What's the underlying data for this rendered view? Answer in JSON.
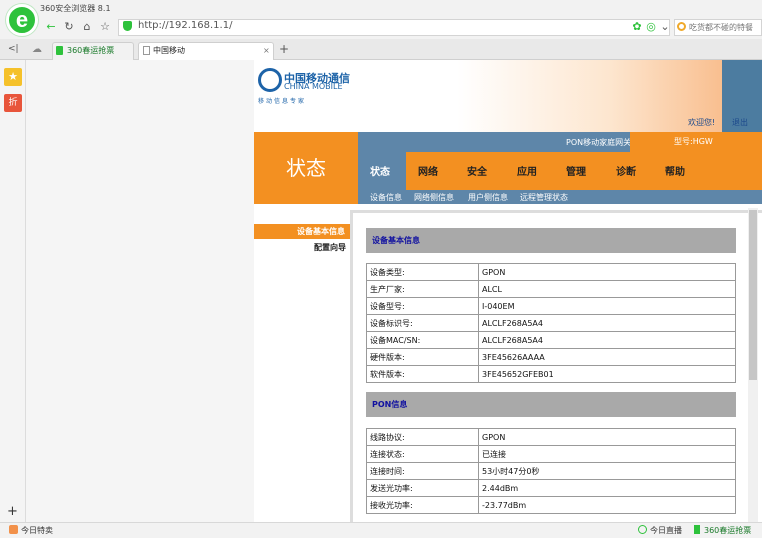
{
  "browser": {
    "app_title": "360安全浏览器 8.1",
    "logo_letter": "e",
    "address": "http://192.168.1.1/",
    "search_placeholder": "吃货都不碰的特餐",
    "nav_icons": [
      "back-icon",
      "forward-icon",
      "refresh-icon",
      "home-icon",
      "star-icon"
    ],
    "tabs": [
      {
        "label": "360春运抢票"
      },
      {
        "label": "中国移动"
      }
    ],
    "new_tab": "+",
    "collapse": "<|"
  },
  "sidebar": {
    "add": "+",
    "coupon_label": "折"
  },
  "statusbar": {
    "left": "今日特卖",
    "live": "今日直播",
    "right": "360春运抢票"
  },
  "router": {
    "brand_cn": "中国移动通信",
    "brand_en": "CHINA MOBILE",
    "slogan": "移动信息专家",
    "welcome": "欢迎您!",
    "logout": "退出",
    "gateway": "PON移动家庭网关",
    "model": "型号:HGW",
    "status_title": "状态",
    "menu": [
      "状态",
      "网络",
      "安全",
      "应用",
      "管理",
      "诊断",
      "帮助"
    ],
    "submenu": [
      "设备信息",
      "网络侧信息",
      "用户侧信息",
      "远程管理状态"
    ],
    "left_nav": {
      "basic": "设备基本信息",
      "wizard": "配置向导"
    },
    "device_section": {
      "title": "设备基本信息",
      "rows": [
        {
          "k": "设备类型:",
          "v": "GPON"
        },
        {
          "k": "生产厂家:",
          "v": "ALCL"
        },
        {
          "k": "设备型号:",
          "v": "I-040EM"
        },
        {
          "k": "设备标识号:",
          "v": "ALCLF268A5A4"
        },
        {
          "k": "设备MAC/SN:",
          "v": "ALCLF268A5A4"
        },
        {
          "k": "硬件版本:",
          "v": "3FE45626AAAA"
        },
        {
          "k": "软件版本:",
          "v": "3FE45652GFEB01"
        }
      ]
    },
    "pon_section": {
      "title": "PON信息",
      "rows": [
        {
          "k": "线路协议:",
          "v": "GPON"
        },
        {
          "k": "连接状态:",
          "v": "已连接"
        },
        {
          "k": "连接时间:",
          "v": "53小时47分0秒"
        },
        {
          "k": "发送光功率:",
          "v": "2.44dBm"
        },
        {
          "k": "接收光功率:",
          "v": "-23.77dBm"
        }
      ]
    }
  }
}
